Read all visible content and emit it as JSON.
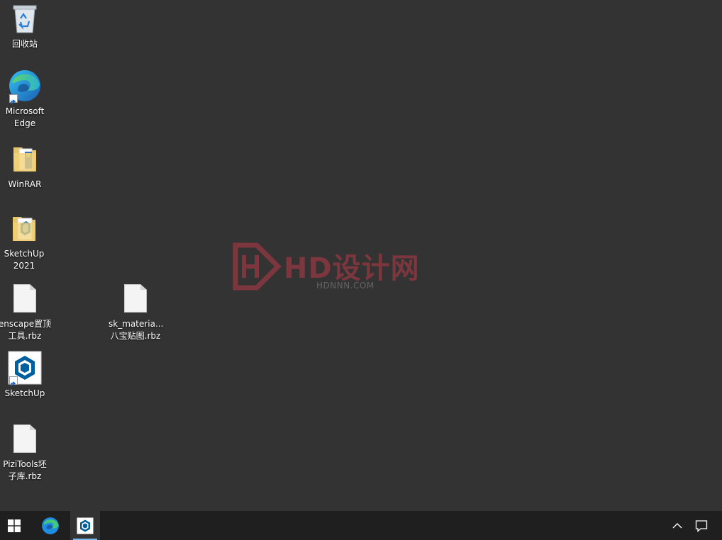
{
  "desktop": {
    "icons": [
      {
        "label": "回收站",
        "icon": "recycle-bin-icon"
      },
      {
        "label": "Microsoft\nEdge",
        "icon": "edge-icon"
      },
      {
        "label": "WinRAR",
        "icon": "winrar-icon"
      },
      {
        "label": "SketchUp\n2021",
        "icon": "sketchup-folder-icon"
      },
      {
        "label": "enscape置顶\n工具.rbz",
        "icon": "file-icon"
      },
      {
        "label": "sk_materia...\n八宝贴图.rbz",
        "icon": "file-icon"
      },
      {
        "label": "SketchUp",
        "icon": "sketchup-icon"
      },
      {
        "label": "PiziTools坯\n子库.rbz",
        "icon": "file-icon"
      }
    ]
  },
  "watermark": {
    "brand": "HD设计网",
    "url": "HDNNN.COM",
    "color": "#b83a46"
  },
  "taskbar": {
    "start": "windows-start-icon",
    "pinned": [
      "edge-icon",
      "sketchup-icon"
    ],
    "tray": [
      "chevron-up-icon",
      "notification-icon"
    ],
    "accent": "#76b9ed"
  }
}
